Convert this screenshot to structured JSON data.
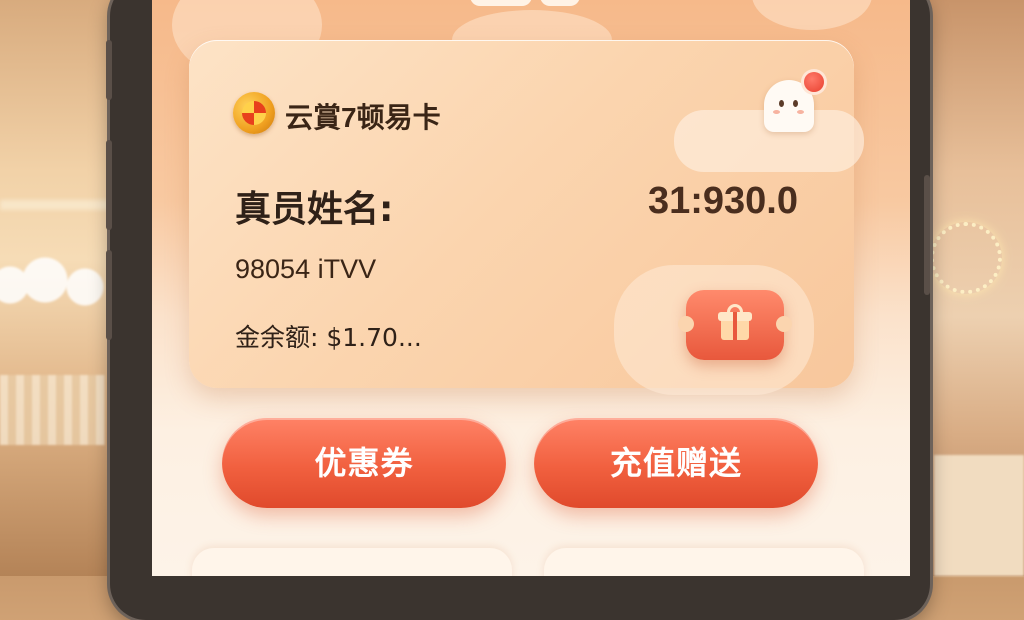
{
  "card": {
    "title": "云賞7顿易卡",
    "member_label": "真员姓名:",
    "balance_value": "31:930.0",
    "member_id": "98054 iTVV",
    "balance_line": "金余额: $1.70..."
  },
  "actions": {
    "coupon_label": "优惠券",
    "recharge_label": "充值赠送"
  },
  "icons": {
    "logo": "shield-logo-icon",
    "mascot": "ghost-mascot-icon",
    "notification": "notification-dot-icon",
    "gift": "gift-ticket-icon"
  },
  "colors": {
    "accent": "#f1603f",
    "card_bg": "#fbd5af",
    "screen_bg": "#f8c9a1"
  }
}
